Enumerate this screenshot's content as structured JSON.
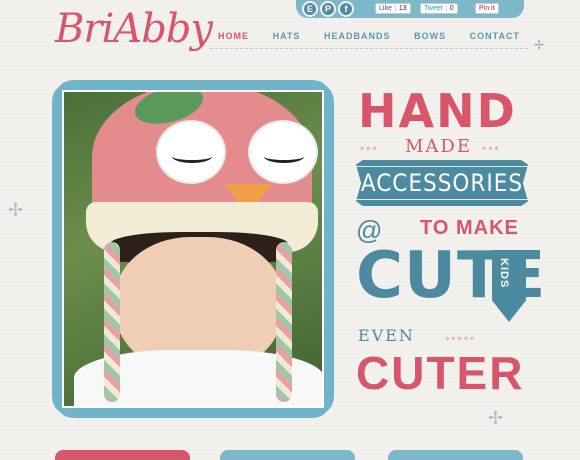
{
  "header": {
    "logo": "BriAbby",
    "social": [
      {
        "label": "E",
        "icon": "etsy-icon"
      },
      {
        "label": "P",
        "icon": "pinterest-icon"
      },
      {
        "label": "f",
        "icon": "facebook-icon"
      }
    ],
    "share": {
      "like_label": "Like",
      "like_count": "13",
      "tweet_label": "Tweet",
      "tweet_count": "0",
      "pin_label": "Pin it"
    }
  },
  "nav": {
    "items": [
      {
        "label": "HOME",
        "active": true
      },
      {
        "label": "HATS",
        "active": false
      },
      {
        "label": "HEADBANDS",
        "active": false
      },
      {
        "label": "BOWS",
        "active": false
      },
      {
        "label": "CONTACT",
        "active": false
      }
    ]
  },
  "hero": {
    "line1": "HAND",
    "line2": "MADE",
    "line3": "ACCESSORIES",
    "line4": "TO MAKE",
    "line5": "CUTE",
    "kids": "KIDS",
    "line6": "EVEN",
    "line7": "CUTER"
  },
  "colors": {
    "accent_pink": "#d7566a",
    "accent_blue": "#4c8aa0",
    "frame_blue": "#6fb4c9"
  }
}
